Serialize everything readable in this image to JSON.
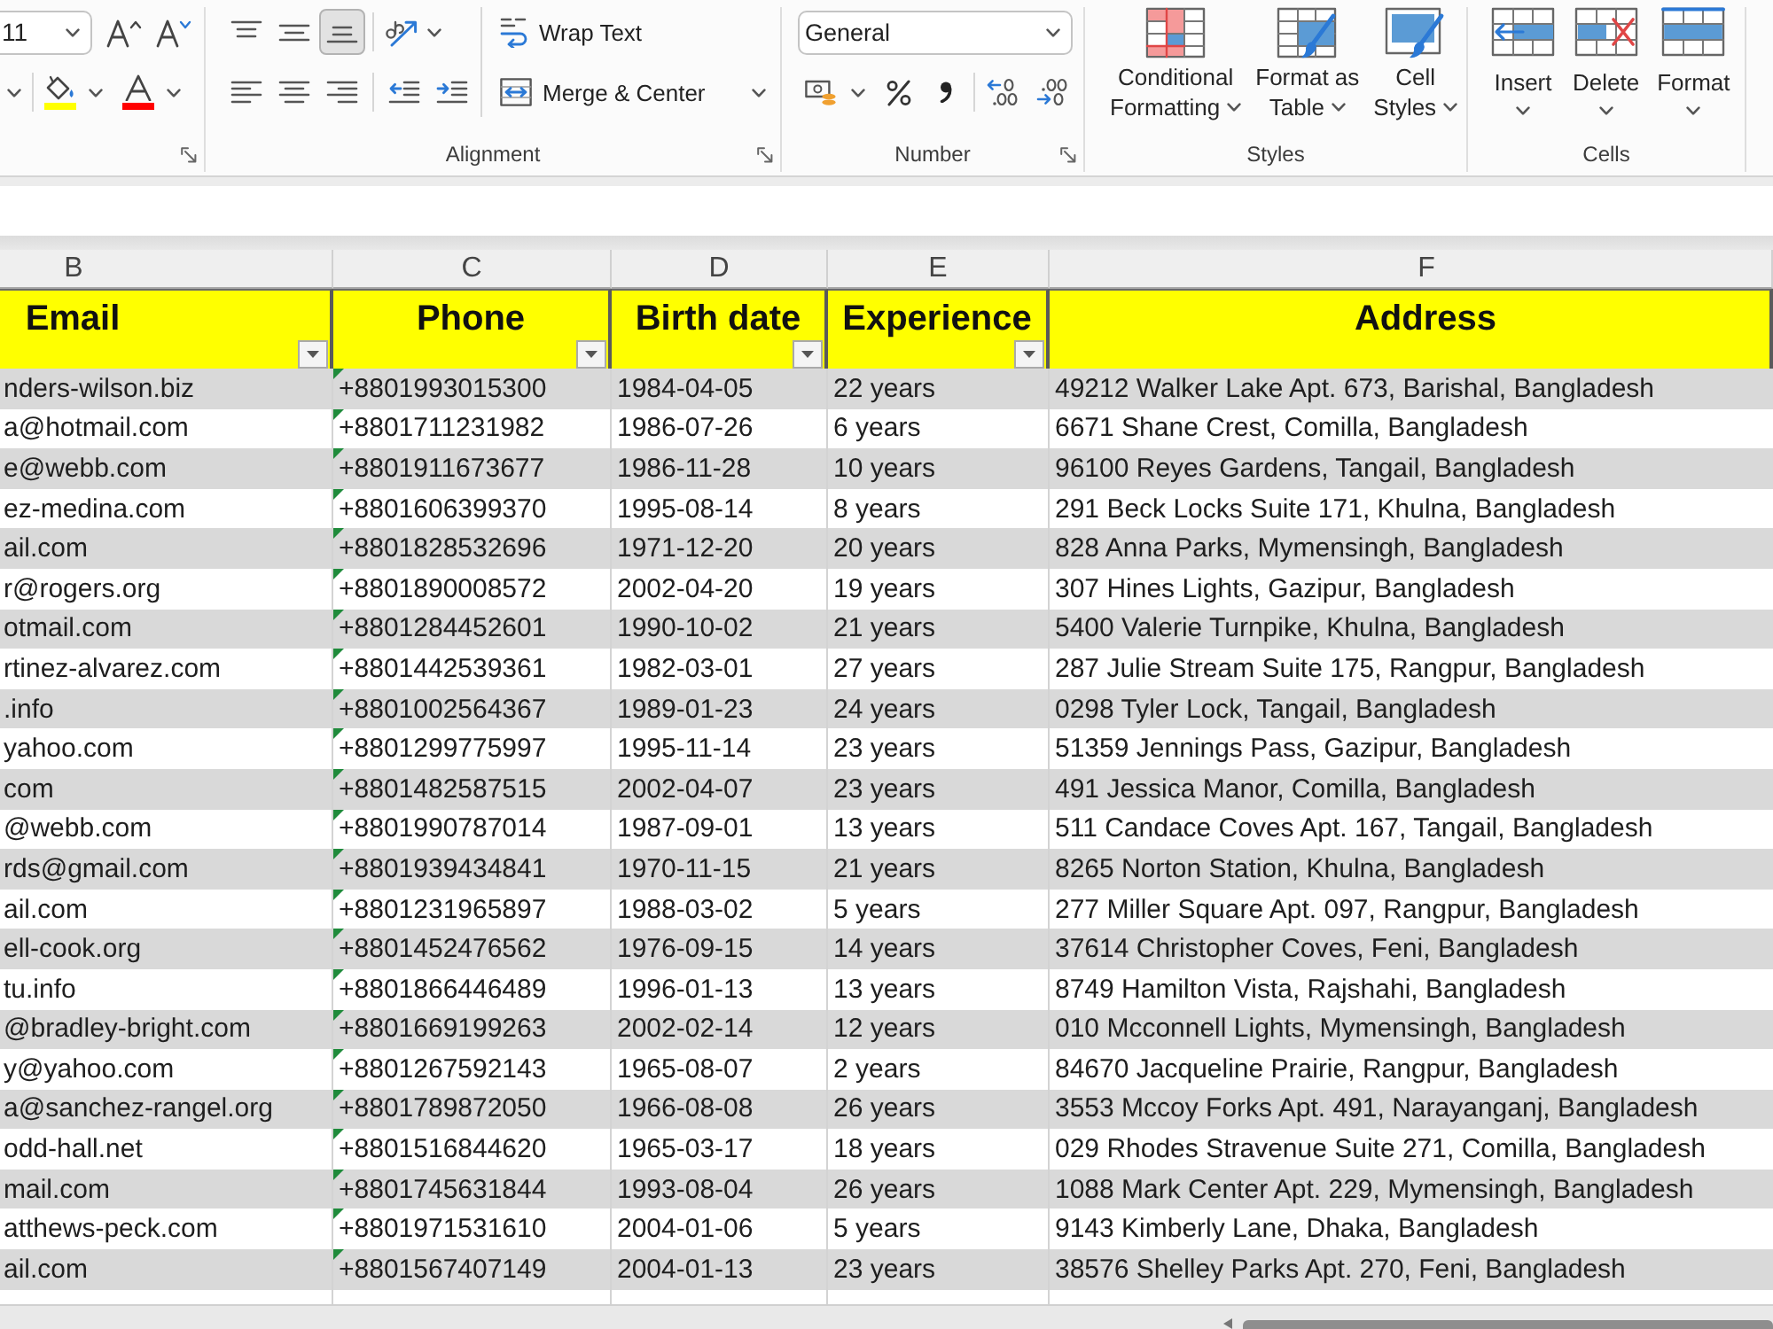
{
  "ribbon": {
    "font": {
      "size": "11",
      "color_tools": [
        {
          "kind": "fill",
          "color": "#ffff00"
        },
        {
          "kind": "font",
          "color": "#ff0000"
        }
      ]
    },
    "alignment": {
      "label": "Alignment",
      "vertical": [
        {
          "kind": "top",
          "selected": false
        },
        {
          "kind": "middle",
          "selected": false
        },
        {
          "kind": "bottom",
          "selected": true
        }
      ],
      "horizontal": [
        {
          "kind": "left",
          "selected": false
        },
        {
          "kind": "center",
          "selected": false
        },
        {
          "kind": "right",
          "selected": false
        }
      ],
      "wrap_text": "Wrap Text",
      "merge": "Merge & Center"
    },
    "number": {
      "label": "Number",
      "format": "General"
    },
    "styles": {
      "label": "Styles",
      "buttons": [
        {
          "kind": "conditional",
          "lines": [
            "Conditional",
            "Formatting"
          ]
        },
        {
          "kind": "table",
          "lines": [
            "Format as",
            "Table"
          ]
        },
        {
          "kind": "cell",
          "lines": [
            "Cell",
            "Styles"
          ]
        }
      ]
    },
    "cells": {
      "label": "Cells",
      "buttons": [
        {
          "kind": "insert",
          "label": "Insert"
        },
        {
          "kind": "delete",
          "label": "Delete"
        },
        {
          "kind": "format",
          "label": "Format"
        }
      ]
    }
  },
  "column_letters": [
    "B",
    "C",
    "D",
    "E",
    "F"
  ],
  "table": {
    "columns": [
      {
        "label": "Email",
        "filter": true,
        "flagged": false
      },
      {
        "label": "Phone",
        "filter": true,
        "flagged": true
      },
      {
        "label": "Birth date",
        "filter": true,
        "flagged": false
      },
      {
        "label": "Experience",
        "filter": true,
        "flagged": false
      },
      {
        "label": "Address",
        "filter": false,
        "flagged": false
      }
    ],
    "rows": [
      [
        "nders-wilson.biz",
        "+8801993015300",
        "1984-04-05",
        "22 years",
        "49212 Walker Lake Apt. 673, Barishal, Bangladesh"
      ],
      [
        "a@hotmail.com",
        "+8801711231982",
        "1986-07-26",
        "6 years",
        "6671 Shane Crest, Comilla, Bangladesh"
      ],
      [
        "e@webb.com",
        "+8801911673677",
        "1986-11-28",
        "10 years",
        "96100 Reyes Gardens, Tangail, Bangladesh"
      ],
      [
        "ez-medina.com",
        "+8801606399370",
        "1995-08-14",
        "8 years",
        "291 Beck Locks Suite 171, Khulna, Bangladesh"
      ],
      [
        "ail.com",
        "+8801828532696",
        "1971-12-20",
        "20 years",
        "828 Anna Parks, Mymensingh, Bangladesh"
      ],
      [
        "r@rogers.org",
        "+8801890008572",
        "2002-04-20",
        "19 years",
        "307 Hines Lights, Gazipur, Bangladesh"
      ],
      [
        "otmail.com",
        "+8801284452601",
        "1990-10-02",
        "21 years",
        "5400 Valerie Turnpike, Khulna, Bangladesh"
      ],
      [
        "rtinez-alvarez.com",
        "+8801442539361",
        "1982-03-01",
        "27 years",
        "287 Julie Stream Suite 175, Rangpur, Bangladesh"
      ],
      [
        ".info",
        "+8801002564367",
        "1989-01-23",
        "24 years",
        "0298 Tyler Lock, Tangail, Bangladesh"
      ],
      [
        "yahoo.com",
        "+8801299775997",
        "1995-11-14",
        "23 years",
        "51359 Jennings Pass, Gazipur, Bangladesh"
      ],
      [
        "com",
        "+8801482587515",
        "2002-04-07",
        "23 years",
        "491 Jessica Manor, Comilla, Bangladesh"
      ],
      [
        "@webb.com",
        "+8801990787014",
        "1987-09-01",
        "13 years",
        "511 Candace Coves Apt. 167, Tangail, Bangladesh"
      ],
      [
        "rds@gmail.com",
        "+8801939434841",
        "1970-11-15",
        "21 years",
        "8265 Norton Station, Khulna, Bangladesh"
      ],
      [
        "ail.com",
        "+8801231965897",
        "1988-03-02",
        "5 years",
        "277 Miller Square Apt. 097, Rangpur, Bangladesh"
      ],
      [
        "ell-cook.org",
        "+8801452476562",
        "1976-09-15",
        "14 years",
        "37614 Christopher Coves, Feni, Bangladesh"
      ],
      [
        "tu.info",
        "+8801866446489",
        "1996-01-13",
        "13 years",
        "8749 Hamilton Vista, Rajshahi, Bangladesh"
      ],
      [
        "@bradley-bright.com",
        "+8801669199263",
        "2002-02-14",
        "12 years",
        "010 Mcconnell Lights, Mymensingh, Bangladesh"
      ],
      [
        "y@yahoo.com",
        "+8801267592143",
        "1965-08-07",
        "2 years",
        "84670 Jacqueline Prairie, Rangpur, Bangladesh"
      ],
      [
        "a@sanchez-rangel.org",
        "+8801789872050",
        "1966-08-08",
        "26 years",
        "3553 Mccoy Forks Apt. 491, Narayanganj, Bangladesh"
      ],
      [
        "odd-hall.net",
        "+8801516844620",
        "1965-03-17",
        "18 years",
        "029 Rhodes Stravenue Suite 271, Comilla, Bangladesh"
      ],
      [
        "mail.com",
        "+8801745631844",
        "1993-08-04",
        "26 years",
        "1088 Mark Center Apt. 229, Mymensingh, Bangladesh"
      ],
      [
        "atthews-peck.com",
        "+8801971531610",
        "2004-01-06",
        "5 years",
        "9143 Kimberly Lane, Dhaka, Bangladesh"
      ],
      [
        "ail.com",
        "+8801567407149",
        "2004-01-13",
        "23 years",
        "38576 Shelley Parks Apt. 270, Feni, Bangladesh"
      ]
    ]
  }
}
